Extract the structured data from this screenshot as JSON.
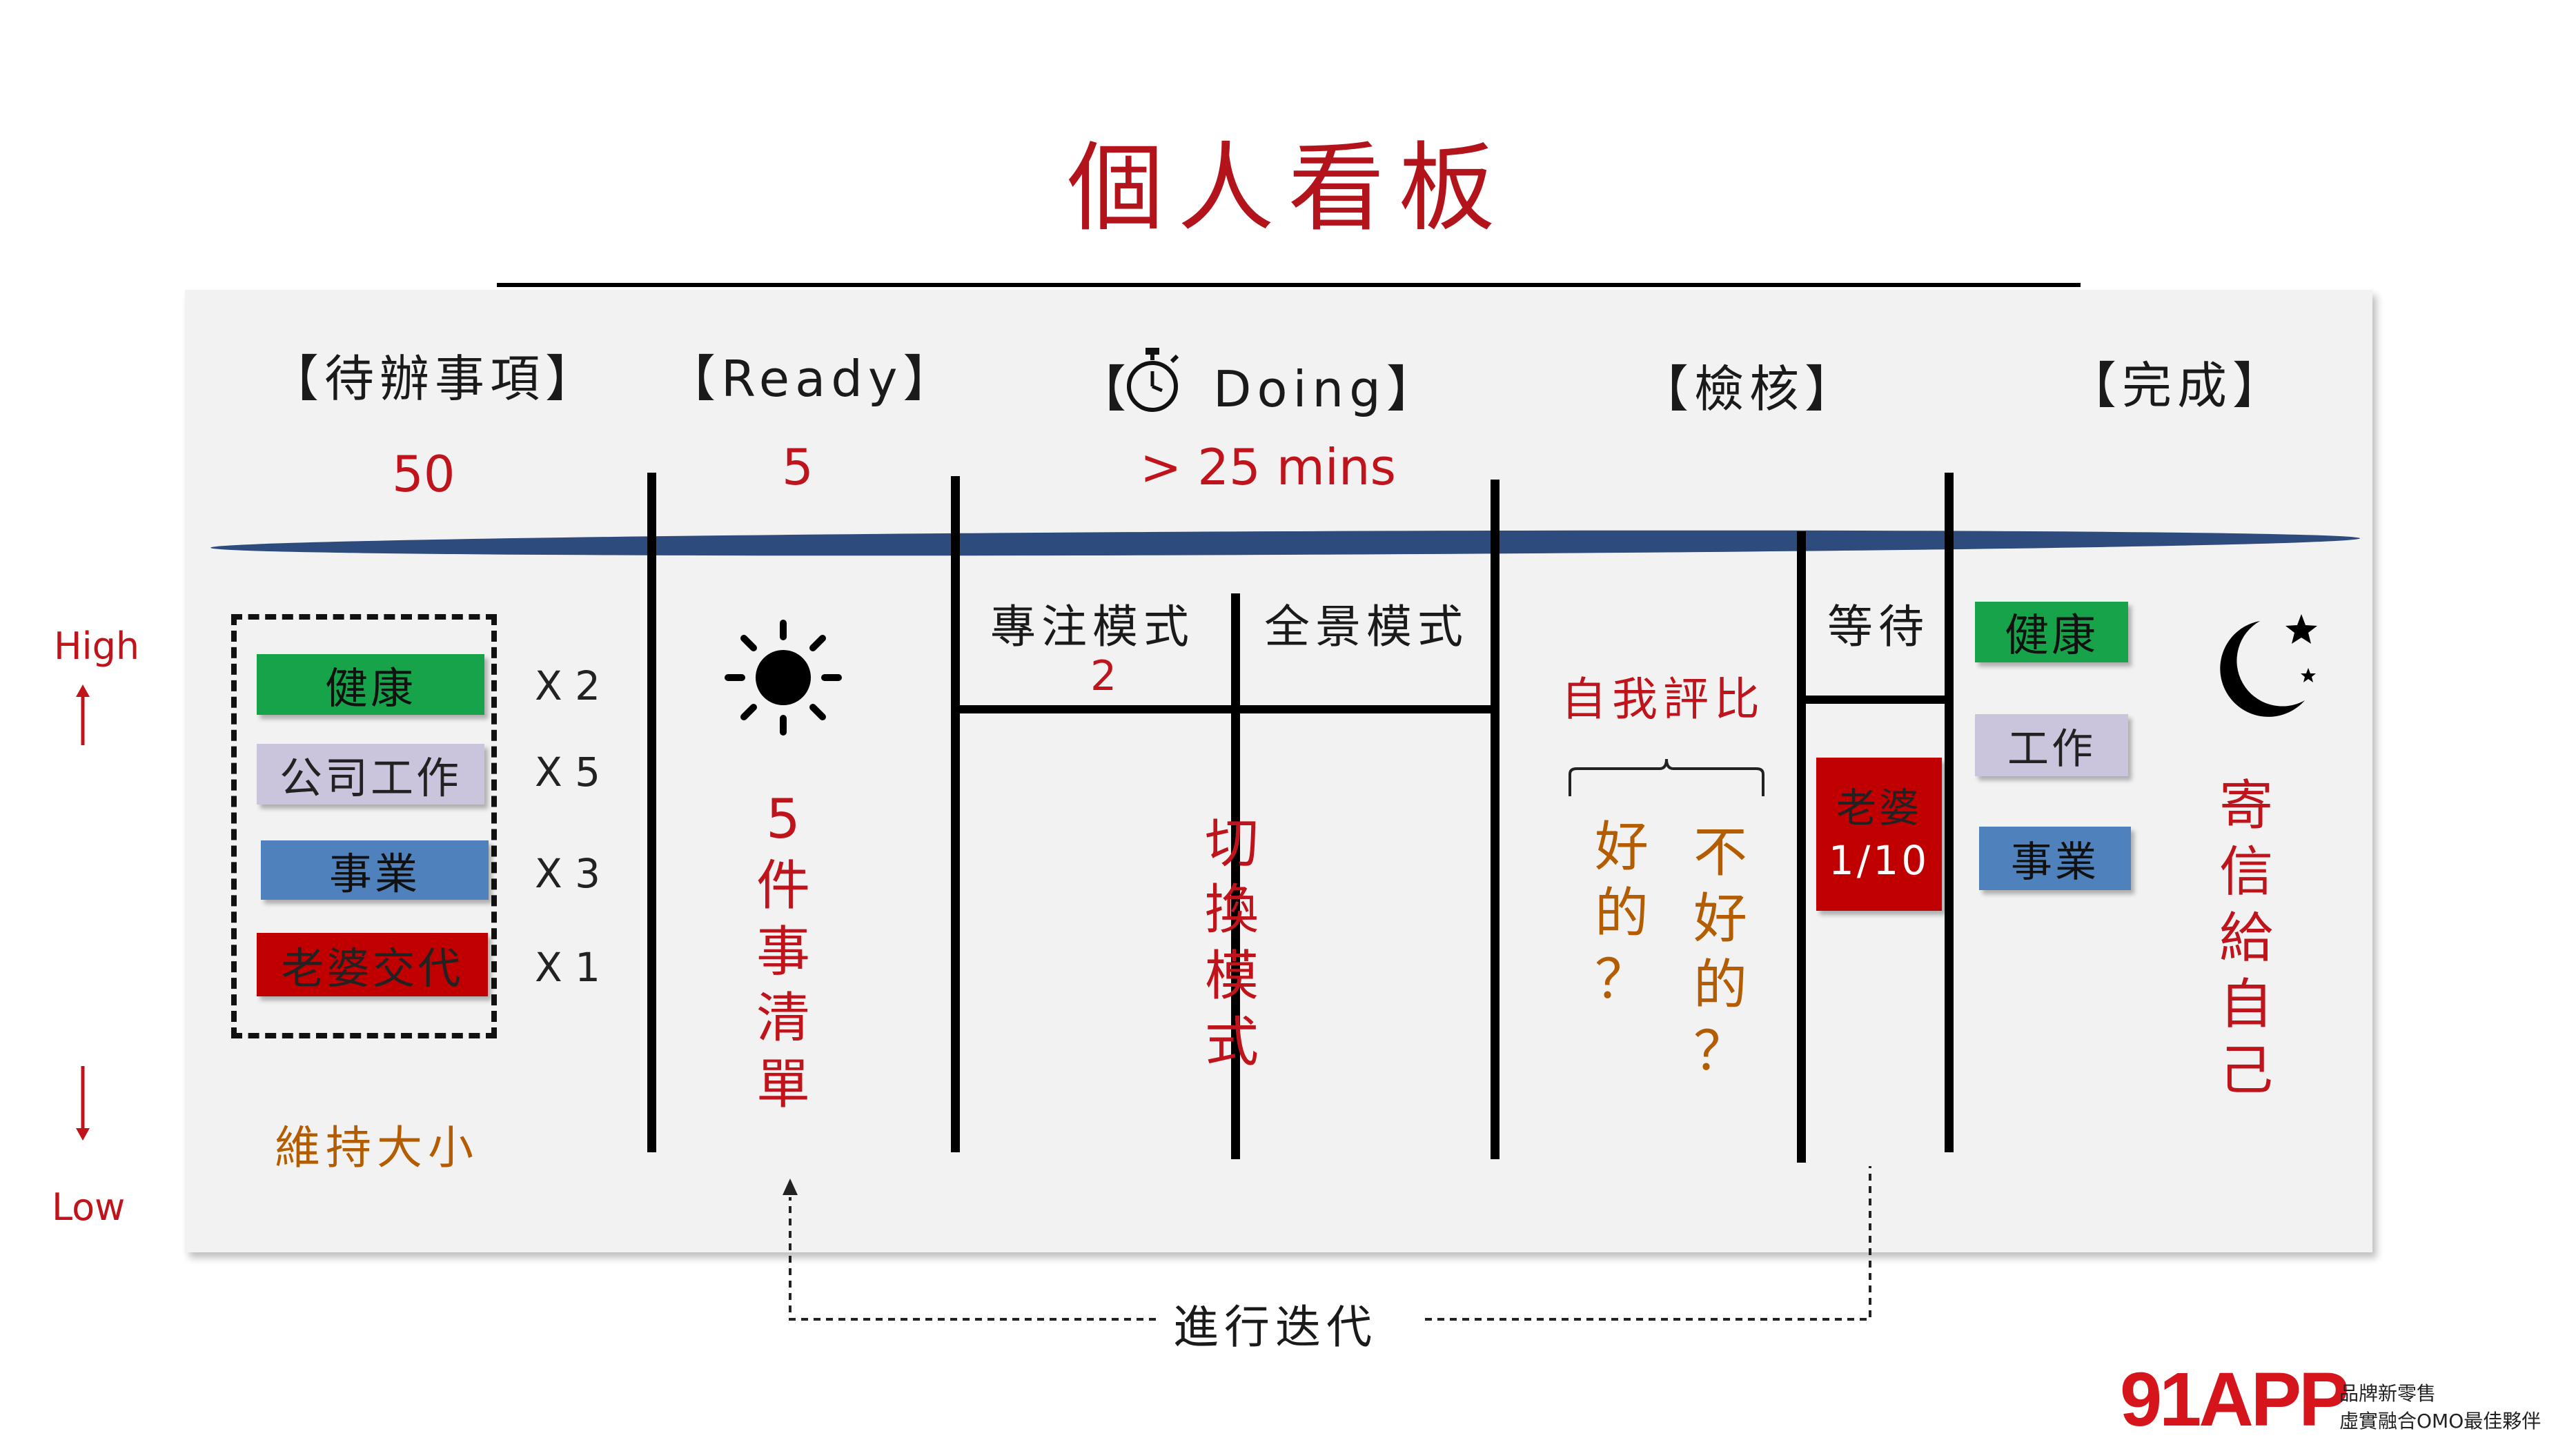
{
  "title": "個人看板",
  "columns": {
    "todo": {
      "header": "【待辦事項】",
      "count": "50"
    },
    "ready": {
      "header": "【Ready】",
      "count": "5"
    },
    "doing": {
      "header_left": "【",
      "header_right": "Doing】",
      "count": "> 25 mins"
    },
    "review": {
      "header": "【檢核】"
    },
    "done": {
      "header": "【完成】"
    }
  },
  "todo_items": [
    {
      "label": "健康",
      "mult": "X 2",
      "color": "#17a34a"
    },
    {
      "label": "公司工作",
      "mult": "X 5",
      "color": "#cbc4dd"
    },
    {
      "label": "事業",
      "mult": "X 3",
      "color": "#4f81bd"
    },
    {
      "label": "老婆交代",
      "mult": "X 1",
      "color": "#c00000"
    }
  ],
  "todo_footer": "維持大小",
  "priority": {
    "high": "High",
    "low": "Low"
  },
  "ready_note": [
    "5",
    "件",
    "事",
    "清",
    "單"
  ],
  "doing_sub": {
    "focus": "專注模式",
    "focus_count": "2",
    "panorama": "全景模式"
  },
  "doing_note": [
    "切",
    "換",
    "模",
    "式"
  ],
  "review_sub": {
    "self_compare": "自我評比",
    "good": [
      "好",
      "的",
      "？"
    ],
    "bad": [
      "不",
      "好",
      "的",
      "？"
    ],
    "waiting": "等待"
  },
  "waiting_card": {
    "line1": "老婆",
    "line2": "1/10"
  },
  "done_items": [
    "健康",
    "工作",
    "事業"
  ],
  "done_note": [
    "寄",
    "信",
    "給",
    "自",
    "己"
  ],
  "iterate": "進行迭代",
  "logo": {
    "brand": "91APP",
    "line1": "品牌新零售",
    "line2": "虛實融合OMO最佳夥伴"
  }
}
